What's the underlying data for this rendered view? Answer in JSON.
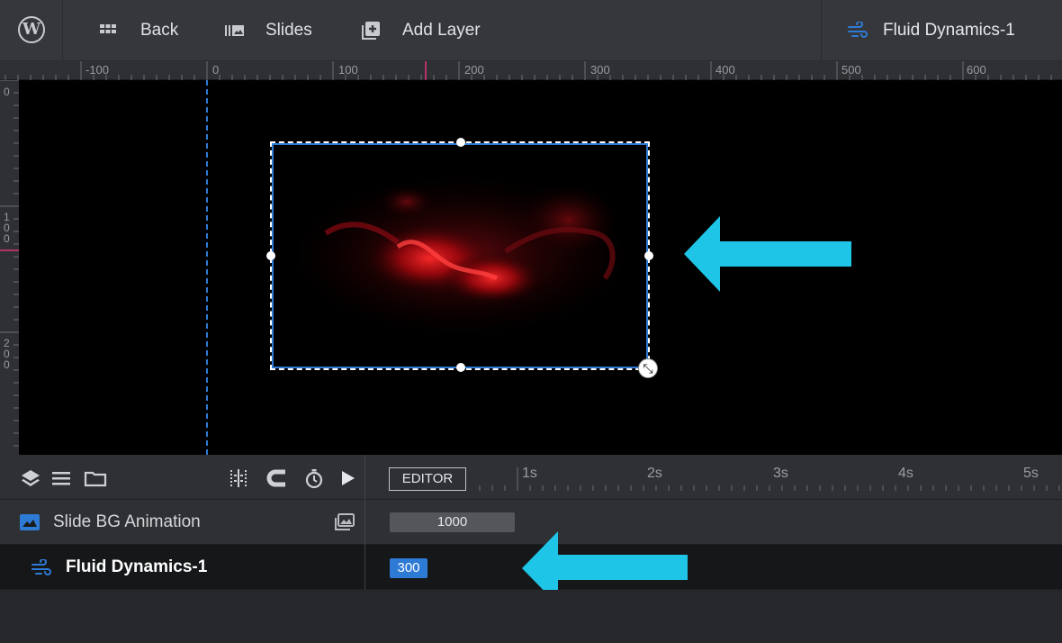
{
  "topbar": {
    "back_label": "Back",
    "slides_label": "Slides",
    "add_layer_label": "Add Layer",
    "current_layer_label": "Fluid Dynamics-1"
  },
  "ruler": {
    "top_ticks": [
      "-100",
      "0",
      "100",
      "200",
      "300",
      "400",
      "500",
      "600"
    ],
    "left_ticks": [
      "0",
      "1\n0\n0",
      "2\n0\n0"
    ]
  },
  "timeline": {
    "editor_label": "EDITOR",
    "time_marks": [
      "1s",
      "2s",
      "3s",
      "4s",
      "5s"
    ]
  },
  "layers": [
    {
      "name": "Slide BG Animation",
      "duration": "1000"
    },
    {
      "name": "Fluid Dynamics-1",
      "duration": "300"
    }
  ],
  "colors": {
    "accent_blue": "#2e7bd6",
    "annotation_arrow": "#1fc5e6",
    "guide_pink": "#e0327a"
  }
}
